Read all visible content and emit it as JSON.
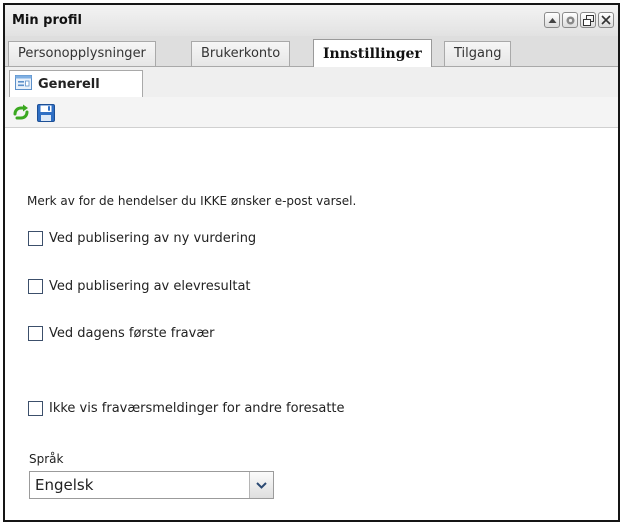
{
  "window": {
    "title": "Min profil",
    "controls": [
      "collapse-icon",
      "gear-icon",
      "restore-icon",
      "close-icon"
    ]
  },
  "tabs": [
    {
      "label": "Personopplysninger",
      "active": false
    },
    {
      "label": "Brukerkonto",
      "active": false
    },
    {
      "label": "Innstillinger",
      "active": true
    },
    {
      "label": "Tilgang",
      "active": false
    }
  ],
  "subtab": {
    "label": "Generell",
    "icon": "settings-form-icon"
  },
  "toolbar": {
    "icons": [
      "refresh-icon",
      "save-icon"
    ]
  },
  "form": {
    "intro": "Merk av for de hendelser du IKKE ønsker e-post varsel.",
    "options": [
      {
        "label": "Ved publisering av ny vurdering",
        "checked": false
      },
      {
        "label": "Ved publisering av elevresultat",
        "checked": false
      },
      {
        "label": "Ved dagens første fravær",
        "checked": false
      },
      {
        "label": "Ikke vis fraværsmeldinger for andre foresatte",
        "checked": false
      }
    ],
    "language_label": "Språk",
    "language_value": "Engelsk"
  },
  "colors": {
    "accent_green": "#3aa81f",
    "save_blue": "#2f6fc4",
    "checkbox_border": "#3c4f6b"
  }
}
